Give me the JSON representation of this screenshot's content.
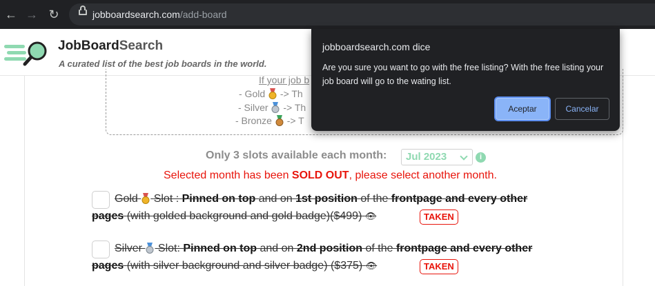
{
  "browser": {
    "url_domain": "jobboardsearch.com",
    "url_path": "/add-board"
  },
  "site": {
    "brand_main": "JobBoard",
    "brand_accent": "Search",
    "tagline": "A curated list of the best job boards in the world."
  },
  "info_box": {
    "line1": "If your job b",
    "gold": "- Gold",
    "gold_rest": "-> Th",
    "silver": "- Silver",
    "silver_rest": "-> Th",
    "bronze": "- Bronze",
    "bronze_rest": "-> T"
  },
  "slots": {
    "text": "Only 3 slots available each month:",
    "selected_month": "Jul 2023",
    "info_icon": "i"
  },
  "soldout": {
    "before": "Selected month has been ",
    "bold": "SOLD OUT",
    "after": ", please select another month."
  },
  "options": [
    {
      "name": "Gold",
      "slot": "Slot :",
      "pinned": "Pinned on top",
      "and_on": "and on",
      "position": "1st position",
      "of_the": "of the",
      "frontpage": "frontpage and every other",
      "pages": "pages",
      "desc": "(with golded background and gold badge)($499)",
      "status": "TAKEN"
    },
    {
      "name": "Silver",
      "slot": "Slot:",
      "pinned": "Pinned on top",
      "and_on": "and on",
      "position": "2nd position",
      "of_the": "of the",
      "frontpage": "frontpage and every other",
      "pages": "pages",
      "desc": "(with silver background and silver badge) ($375)",
      "status": "TAKEN"
    }
  ],
  "dialog": {
    "title": "jobboardsearch.com dice",
    "message": "Are you sure you want to go with the free listing? With the free listing your job board will go to the wating list.",
    "ok_label": "Aceptar",
    "cancel_label": "Cancelar"
  },
  "colors": {
    "chrome_bg": "#202124",
    "accent_green": "#8fd9b1",
    "error_red": "#e8140b",
    "dialog_button_blue": "#8ab4f8"
  }
}
